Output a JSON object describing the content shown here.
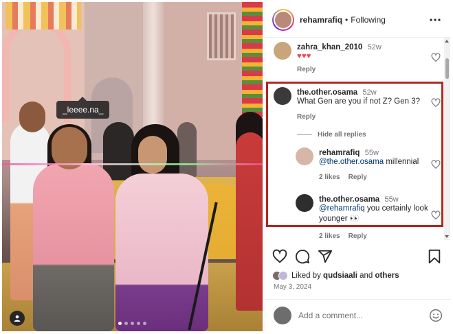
{
  "photo": {
    "tag_label": "_leeee.na_",
    "carousel": {
      "count": 5,
      "active": 1
    }
  },
  "post": {
    "author": "rehamrafiq",
    "separator": "•",
    "follow_status": "Following"
  },
  "comments": [
    {
      "user": "zahra_khan_2010",
      "time": "52w",
      "text": "♥♥♥",
      "reply_label": "Reply"
    },
    {
      "user": "the.other.osama",
      "time": "52w",
      "text": "What Gen are you if not Z? Gen 3?",
      "reply_label": "Reply"
    }
  ],
  "hide_replies_label": "Hide all replies",
  "replies": [
    {
      "user": "rehamrafiq",
      "time": "55w",
      "mention": "@the.other.osama",
      "text": " millennial",
      "likes": "2 likes",
      "reply_label": "Reply"
    },
    {
      "user": "the.other.osama",
      "time": "55w",
      "mention": "@rehamrafiq",
      "text": " you certainly look younger 👀",
      "likes": "2 likes",
      "reply_label": "Reply"
    }
  ],
  "likes": {
    "prefix": "Liked by",
    "user": "qudsiaali",
    "and": "and",
    "others": "others"
  },
  "date": "May 3, 2024",
  "add_comment": {
    "placeholder": "Add a comment..."
  },
  "colors": {
    "highlight_border": "#b3261e",
    "mention": "#00376b",
    "heart": "#ed4956"
  },
  "icons": [
    "user-tag-icon",
    "more-icon",
    "heart-icon",
    "comment-icon",
    "share-icon",
    "bookmark-icon",
    "emoji-icon"
  ]
}
